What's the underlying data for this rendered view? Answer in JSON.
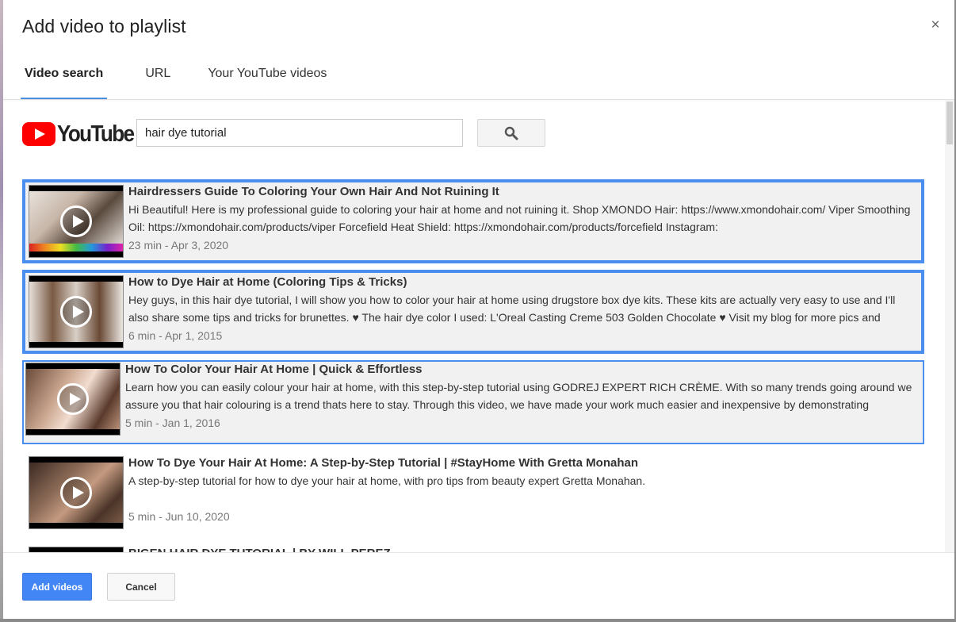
{
  "dialog": {
    "title": "Add video to playlist",
    "close_symbol": "×"
  },
  "tabs": [
    {
      "label": "Video search",
      "active": true
    },
    {
      "label": "URL",
      "active": false
    },
    {
      "label": "Your YouTube videos",
      "active": false
    }
  ],
  "search": {
    "logo_text": "YouTube",
    "query": "hair dye tutorial",
    "button_icon": "search-icon"
  },
  "results": [
    {
      "title": "Hairdressers Guide To Coloring Your Own Hair And Not Ruining It",
      "description": "Hi Beautiful! Here is my professional guide to coloring your hair at home and not ruining it. Shop XMONDO Hair: https://www.xmondohair.com/ Viper Smoothing Oil: https://xmondohair.com/products/viper Forcefield Heat Shield: https://xmondohair.com/products/forcefield Instagram:",
      "meta": "23 min - Apr 3, 2020",
      "state": "selected"
    },
    {
      "title": "How to Dye Hair at Home (Coloring Tips & Tricks)",
      "description": "Hey guys, in this hair dye tutorial, I will show you how to color your hair at home using drugstore box dye kits. These kits are actually very easy to use and I'll also share some tips and tricks for brunettes. ♥ The hair dye color I used: L'Oreal Casting Creme 503 Golden Chocolate ♥ Visit my blog for more pics and",
      "meta": "6 min - Apr 1, 2015",
      "state": "selected"
    },
    {
      "title": "How To Color Your Hair At Home | Quick & Effortless",
      "description": "Learn how you can easily colour your hair at home, with this step-by-step tutorial using GODREJ EXPERT RICH CRÈME. With so many trends going around we assure you that hair colouring is a trend thats here to stay. Through this video, we have made your work much easier and inexpensive by demonstrating",
      "meta": "5 min - Jan 1, 2016",
      "state": "focused"
    },
    {
      "title": "How To Dye Your Hair At Home: A Step-by-Step Tutorial | #StayHome With Gretta Monahan",
      "description": "A step-by-step tutorial for how to dye your hair at home, with pro tips from beauty expert Gretta Monahan.",
      "meta": "5 min - Jun 10, 2020",
      "state": "normal"
    },
    {
      "title": "BIGEN HAIR DYE TUTORIAL | BY WILL PEREZ",
      "description": "",
      "meta": "",
      "state": "normal"
    }
  ],
  "footer": {
    "add_label": "Add videos",
    "cancel_label": "Cancel"
  },
  "colors": {
    "accent": "#4285f4",
    "selected_border": "#4a8ef0",
    "youtube_red": "#ff0000"
  }
}
